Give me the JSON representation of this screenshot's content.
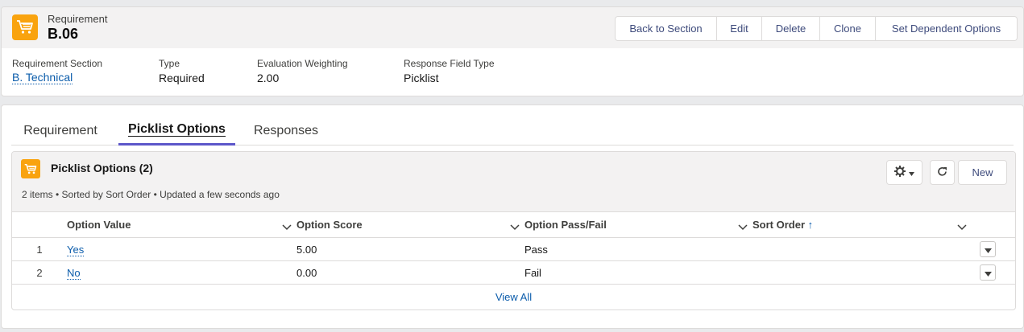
{
  "record": {
    "object_label": "Requirement",
    "name": "B.06",
    "icon": "cart-icon",
    "accent_color": "#f9a30f"
  },
  "actions": [
    "Back to Section",
    "Edit",
    "Delete",
    "Clone",
    "Set Dependent Options"
  ],
  "fields": [
    {
      "label": "Requirement Section",
      "value": "B. Technical"
    },
    {
      "label": "Type",
      "value": "Required"
    },
    {
      "label": "Evaluation Weighting",
      "value": "2.00"
    },
    {
      "label": "Response Field Type",
      "value": "Picklist"
    }
  ],
  "tabs": [
    {
      "label": "Requirement"
    },
    {
      "label": "Picklist Options"
    },
    {
      "label": "Responses"
    }
  ],
  "active_tab": "Picklist Options",
  "related_list": {
    "title": "Picklist Options (2)",
    "meta": "2 items • Sorted by Sort Order • Updated a few seconds ago",
    "new_label": "New",
    "columns": [
      "Option Value",
      "Option Score",
      "Option Pass/Fail",
      "Sort Order"
    ],
    "sort_indicator": "↑",
    "rows": [
      {
        "num": "1",
        "value": "Yes",
        "score": "5.00",
        "pass_fail": "Pass",
        "sort_order": ""
      },
      {
        "num": "2",
        "value": "No",
        "score": "0.00",
        "pass_fail": "Fail",
        "sort_order": ""
      }
    ],
    "view_all": "View All"
  }
}
